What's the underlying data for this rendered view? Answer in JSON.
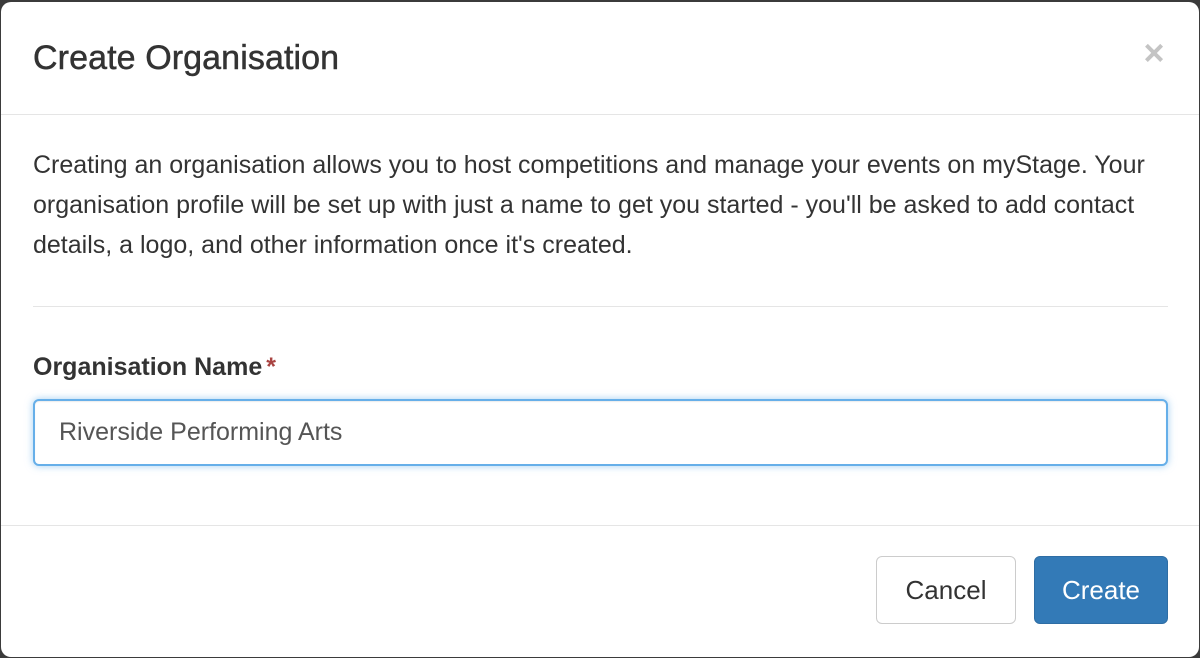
{
  "modal": {
    "title": "Create Organisation",
    "close_symbol": "×",
    "intro": "Creating an organisation allows you to host competitions and manage your events on myStage. Your organisation profile will be set up with just a name to get you started - you'll be asked to add contact details, a logo, and other information once it's created.",
    "field": {
      "label": "Organisation Name",
      "required_mark": "*",
      "value": "Riverside Performing Arts"
    },
    "footer": {
      "cancel_label": "Cancel",
      "create_label": "Create"
    }
  },
  "colors": {
    "primary": "#337ab7",
    "required": "#a94442",
    "focus_border": "#66afe9"
  }
}
